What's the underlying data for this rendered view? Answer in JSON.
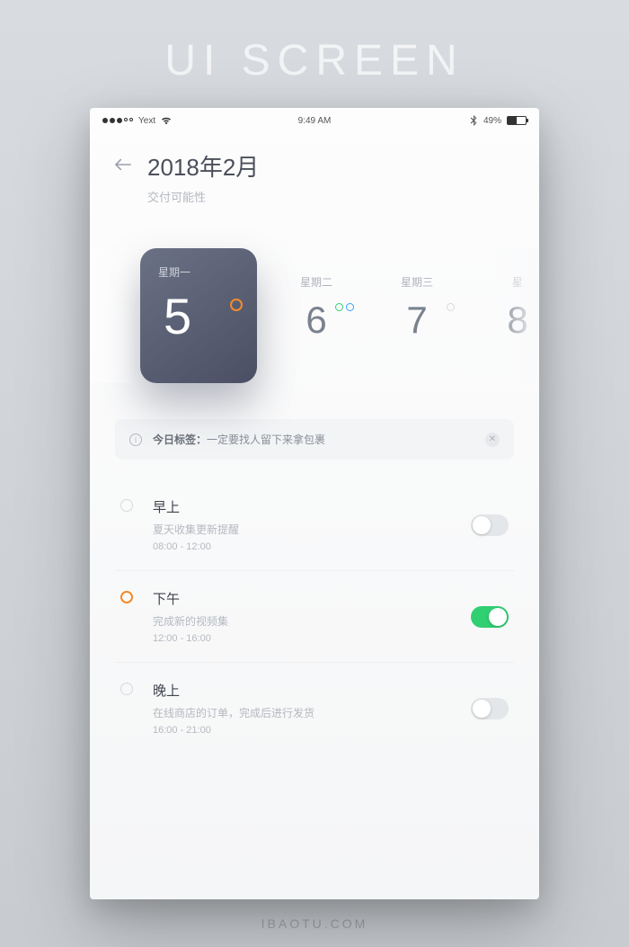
{
  "bg": {
    "title": "UI SCREEN",
    "footer": "IBAOTU.COM"
  },
  "status": {
    "carrier": "Yext",
    "time": "9:49 AM",
    "battery": "49%"
  },
  "header": {
    "title": "2018年2月",
    "subtitle": "交付可能性"
  },
  "days": [
    {
      "weekday": "星期一",
      "num": "5",
      "selected": true
    },
    {
      "weekday": "星期二",
      "num": "6"
    },
    {
      "weekday": "星期三",
      "num": "7"
    },
    {
      "weekday": "星",
      "num": "8"
    }
  ],
  "tag": {
    "label": "今日标签：",
    "text": "一定要找人留下来拿包裹"
  },
  "slots": [
    {
      "title": "早上",
      "desc": "夏天收集更新提醒",
      "time": "08:00 - 12:00",
      "on": false,
      "active": false
    },
    {
      "title": "下午",
      "desc": "完成新的视频集",
      "time": "12:00 - 16:00",
      "on": true,
      "active": true
    },
    {
      "title": "晚上",
      "desc": "在线商店的订单，完成后进行发货",
      "time": "16:00 - 21:00",
      "on": false,
      "active": false
    }
  ]
}
